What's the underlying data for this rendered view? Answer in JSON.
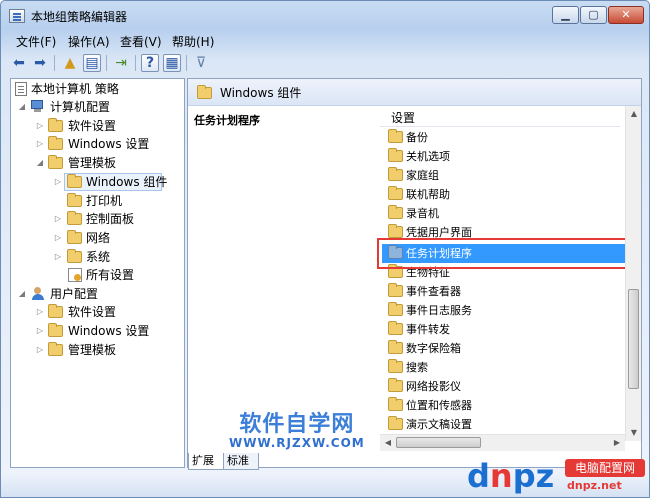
{
  "window": {
    "title": "本地组策略编辑器"
  },
  "menu": [
    "文件(F)",
    "操作(A)",
    "查看(V)",
    "帮助(H)"
  ],
  "tree": {
    "root": "本地计算机 策略",
    "computer": "计算机配置",
    "software": "软件设置",
    "windows": "Windows 设置",
    "admin": "管理模板",
    "win_comp": "Windows 组件",
    "printers": "打印机",
    "control": "控制面板",
    "network": "网络",
    "system": "系统",
    "all": "所有设置",
    "user": "用户配置",
    "u_software": "软件设置",
    "u_windows": "Windows 设置",
    "u_admin": "管理模板"
  },
  "right": {
    "header": "Windows 组件",
    "desc_title": "任务计划程序",
    "column": "设置",
    "items": [
      "备份",
      "关机选项",
      "家庭组",
      "联机帮助",
      "录音机",
      "凭据用户界面",
      "任务计划程序",
      "生物特征",
      "事件查看器",
      "事件日志服务",
      "事件转发",
      "数字保险箱",
      "搜索",
      "网络投影仪",
      "位置和传感器",
      "演示文稿设置"
    ]
  },
  "tabs": [
    "扩展",
    "标准"
  ],
  "watermark": {
    "title": "软件自学网",
    "url": "WWW.RJZXW.COM"
  },
  "logo": {
    "d": "d",
    "n": "n",
    "z": "z",
    "dot": ".",
    "net": "net",
    "cn": "电脑配置网",
    "url": "dnpz.net"
  }
}
